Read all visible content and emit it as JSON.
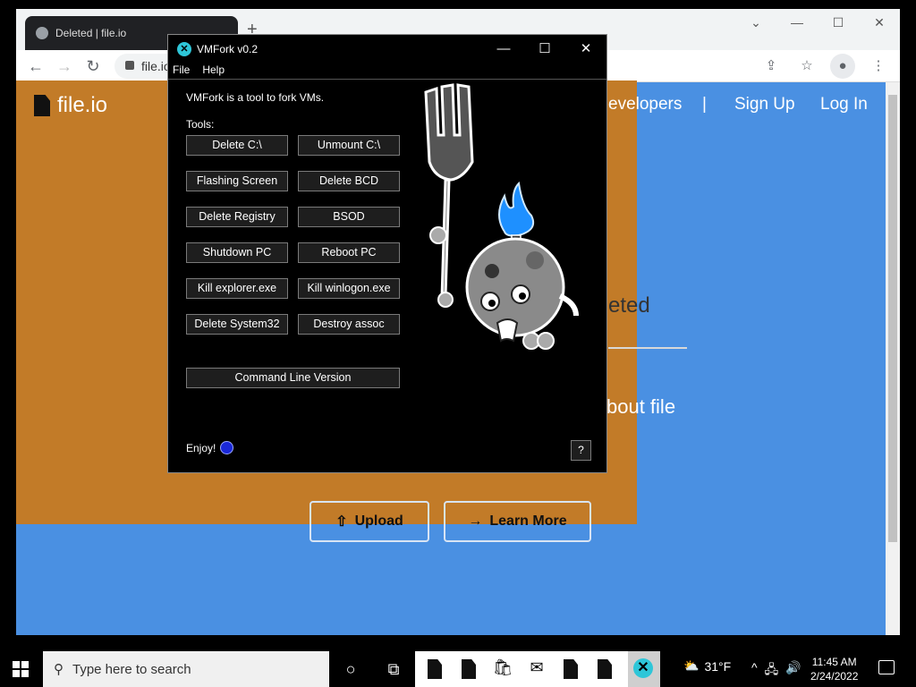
{
  "browser": {
    "tab_title": "Deleted | file.io",
    "new_tab": "+",
    "address_text": "file.io",
    "nav": {
      "back": "←",
      "forward": "→",
      "reload": "↻"
    },
    "window_controls": {
      "dropdown": "⌄",
      "minimize": "—",
      "maximize": "☐",
      "close": "✕"
    },
    "toolbar_icons": {
      "share": "⇪",
      "bookmark": "☆",
      "profile": "●",
      "menu": "⋮"
    }
  },
  "site": {
    "logo": "file.io",
    "nav": {
      "developers": "evelopers",
      "separator": "|",
      "signup": "Sign Up",
      "login": "Log In"
    },
    "heading_partial": "eted",
    "subheading_partial": "bout file",
    "buttons": {
      "upload": "Upload",
      "learn_more": "Learn More"
    }
  },
  "vmfork": {
    "title": "VMFork v0.2",
    "app_icon": "✕",
    "window_controls": {
      "minimize": "—",
      "maximize": "☐",
      "close": "✕"
    },
    "menu": {
      "file": "File",
      "help": "Help"
    },
    "description": "VMFork is a tool to fork VMs.",
    "tools_label": "Tools:",
    "buttons": {
      "delete_c": "Delete C:\\",
      "unmount_c": "Unmount C:\\",
      "flashing_screen": "Flashing Screen",
      "delete_bcd": "Delete BCD",
      "delete_registry": "Delete Registry",
      "bsod": "BSOD",
      "shutdown_pc": "Shutdown PC",
      "reboot_pc": "Reboot PC",
      "kill_explorer": "Kill explorer.exe",
      "kill_winlogon": "Kill winlogon.exe",
      "delete_system32": "Delete System32",
      "destroy_assoc": "Destroy assoc",
      "command_line": "Command Line Version"
    },
    "enjoy": "Enjoy!",
    "help_button": "?"
  },
  "taskbar": {
    "search_placeholder": "Type here to search",
    "weather": "31°F",
    "time": "11:45 AM",
    "date": "2/24/2022",
    "colors": {
      "taskbar": "#000000",
      "active_app": "#cfcfcf"
    }
  },
  "colors": {
    "site_blue": "#4a90e2",
    "overlay_orange": "#c27b28",
    "vm_background": "#000000"
  }
}
